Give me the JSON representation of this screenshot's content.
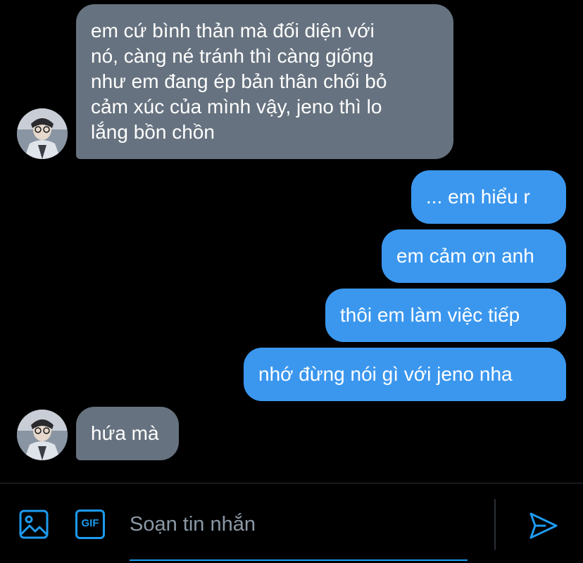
{
  "colors": {
    "incoming_bubble": "#66727f",
    "outgoing_bubble": "#3b97ee",
    "accent": "#1d9bf0",
    "background": "#000000",
    "placeholder": "#8b98a5"
  },
  "messages": [
    {
      "direction": "incoming",
      "lines": [
        "em cứ bình thản mà đối diện với",
        "nó, càng né tránh thì càng giống",
        "như em đang ép bản thân chối bỏ",
        "cảm xúc của mình vậy, jeno thì lo",
        "lắng bồn chồn"
      ]
    },
    {
      "direction": "outgoing",
      "text": "... em hiểu r"
    },
    {
      "direction": "outgoing",
      "text": "em cảm ơn anh"
    },
    {
      "direction": "outgoing",
      "text": "thôi em làm việc tiếp"
    },
    {
      "direction": "outgoing",
      "text": "nhớ đừng nói gì với jeno nha"
    },
    {
      "direction": "incoming",
      "text": "hứa mà"
    }
  ],
  "composer": {
    "placeholder": "Soạn tin nhắn",
    "gif_label": "GIF",
    "icons": [
      "image-icon",
      "gif-icon",
      "send-icon"
    ]
  }
}
